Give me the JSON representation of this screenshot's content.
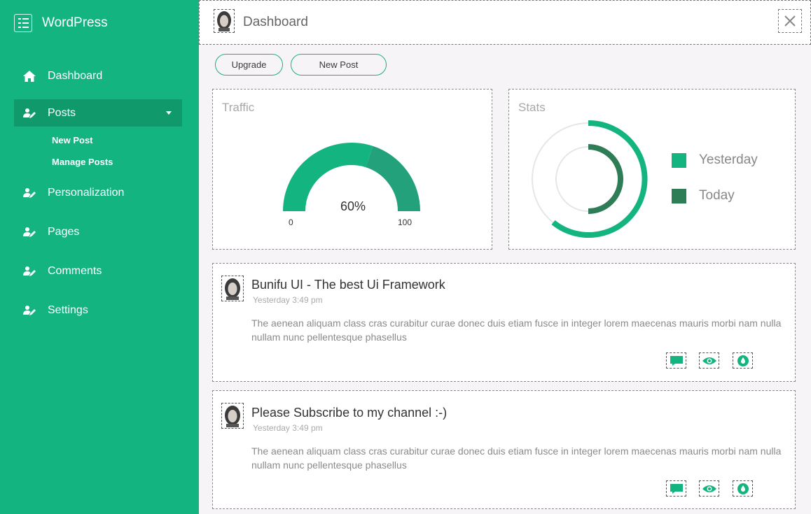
{
  "brand": {
    "name": "WordPress"
  },
  "sidebar": {
    "items": [
      {
        "label": "Dashboard"
      },
      {
        "label": "Posts"
      },
      {
        "label": "Personalization"
      },
      {
        "label": "Pages"
      },
      {
        "label": "Comments"
      },
      {
        "label": "Settings"
      }
    ],
    "posts_sub": [
      {
        "label": "New Post"
      },
      {
        "label": "Manage Posts"
      }
    ]
  },
  "header": {
    "title": "Dashboard"
  },
  "toolbar": {
    "upgrade_label": "Upgrade",
    "new_post_label": "New Post"
  },
  "traffic": {
    "title": "Traffic",
    "value_label": "60%",
    "value_fraction": 0.6,
    "min_label": "0",
    "max_label": "100"
  },
  "stats": {
    "title": "Stats",
    "legend": [
      {
        "label": "Yesterday",
        "color": "#13b47f"
      },
      {
        "label": "Today",
        "color": "#2e7d57"
      }
    ]
  },
  "posts": [
    {
      "title": "Bunifu UI - The best Ui Framework",
      "time": "Yesterday 3:49 pm",
      "body": "The aenean aliquam class cras curabitur curae donec duis etiam fusce in integer lorem maecenas mauris morbi nam nulla nullam nunc pellentesque phasellus"
    },
    {
      "title": "Please Subscribe to my channel :-)",
      "time": "Yesterday 3:49 pm",
      "body": "The aenean aliquam class cras curabitur curae donec duis etiam fusce in integer lorem maecenas mauris morbi nam nulla nullam nunc pellentesque phasellus"
    }
  ],
  "colors": {
    "accent": "#13b47f",
    "accent_dark": "#109a6c",
    "today": "#2e7d57"
  }
}
